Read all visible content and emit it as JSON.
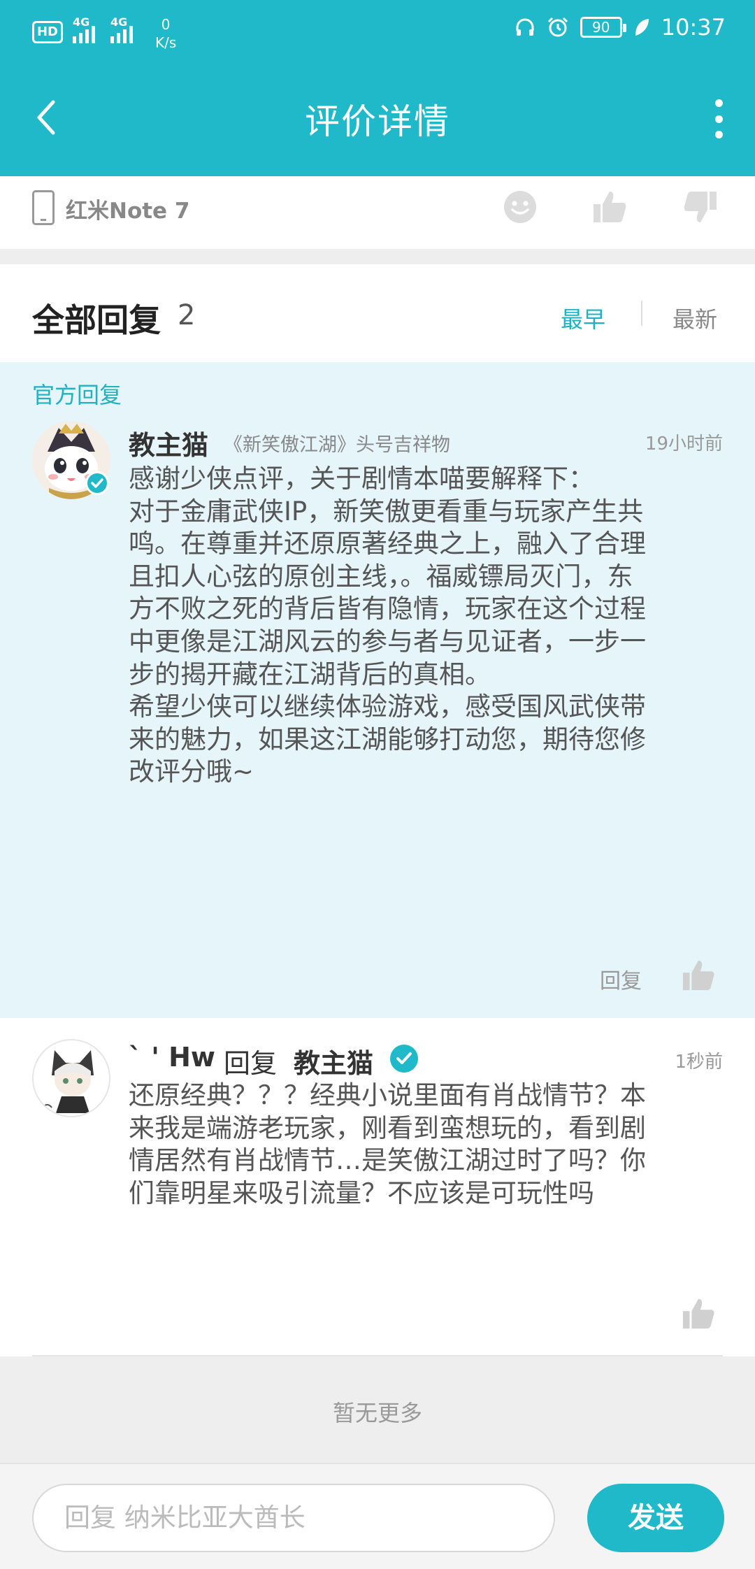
{
  "status_bar": {
    "hd_label": "HD",
    "sim_label": "1",
    "net_label_1": "4G",
    "net_label_2": "4G",
    "speed_value": "0",
    "speed_unit": "K/s",
    "battery": "90",
    "time": "10:37"
  },
  "header": {
    "title": "评价详情"
  },
  "device": {
    "name": "红米Note 7"
  },
  "replies": {
    "title": "全部回复",
    "count": "2",
    "sort_earliest": "最早",
    "sort_latest": "最新"
  },
  "official_reply": {
    "tag": "官方回复",
    "author": "教主猫",
    "author_title": "《新笑傲江湖》头号吉祥物",
    "time": "19小时前",
    "lines": [
      "感谢少侠点评，关于剧情本喵要解释下：",
      "对于金庸武侠IP，新笑傲更看重与玩家产生共",
      "鸣。在尊重并还原原著经典之上，融入了合理",
      "且扣人心弦的原创主线，。福威镖局灭门，东",
      "方不败之死的背后皆有隐情，玩家在这个过程",
      "中更像是江湖风云的参与者与见证者，一步一",
      "步的揭开藏在江湖背后的真相。",
      "希望少侠可以继续体验游戏，感受国风武侠带",
      "来的魅力，如果这江湖能够打动您，期待您修",
      "改评分哦~"
    ],
    "reply_label": "回复"
  },
  "user_reply": {
    "author": "` ' Hw",
    "reply_word": "回复",
    "target": "教主猫",
    "time": "1秒前",
    "lines": [
      "还原经典？？？经典小说里面有肖战情节？本",
      "来我是端游老玩家，刚看到蛮想玩的，看到剧",
      "情居然有肖战情节…是笑傲江湖过时了吗？你",
      "们靠明星来吸引流量？不应该是可玩性吗"
    ]
  },
  "footer_note": "暂无更多",
  "input": {
    "placeholder": "回复 纳米比亚大酋长",
    "send_label": "发送"
  },
  "colors": {
    "accent": "#1fb9c9",
    "official_bg": "#e6f5f9"
  }
}
